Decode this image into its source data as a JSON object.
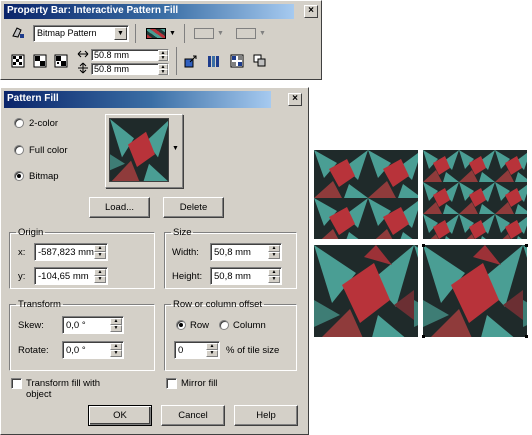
{
  "property_bar": {
    "title": "Property Bar: Interactive Pattern Fill",
    "fill_type": "Bitmap Pattern",
    "width_value": "50.8 mm",
    "height_value": "50.8 mm"
  },
  "dialog": {
    "title": "Pattern Fill",
    "radio_two_color": "2-color",
    "radio_full_color": "Full color",
    "radio_bitmap": "Bitmap",
    "selected_type": "Bitmap",
    "load_label": "Load...",
    "delete_label": "Delete",
    "origin": {
      "legend": "Origin",
      "x_label": "x:",
      "x_value": "-587,823 mm",
      "y_label": "y:",
      "y_value": "-104,65 mm"
    },
    "size": {
      "legend": "Size",
      "width_label": "Width:",
      "width_value": "50,8 mm",
      "height_label": "Height:",
      "height_value": "50,8 mm"
    },
    "transform": {
      "legend": "Transform",
      "skew_label": "Skew:",
      "skew_value": "0,0 °",
      "rotate_label": "Rotate:",
      "rotate_value": "0,0 °"
    },
    "offset": {
      "legend": "Row or column offset",
      "row_label": "Row",
      "column_label": "Column",
      "selected": "Row",
      "amount_value": "0",
      "amount_suffix": "% of tile size"
    },
    "transform_fill_label": "Transform fill with object",
    "mirror_fill_label": "Mirror fill",
    "ok_label": "OK",
    "cancel_label": "Cancel",
    "help_label": "Help"
  },
  "colors": {
    "pattern_red": "#b8333a",
    "pattern_teal": "#4a9e94",
    "pattern_dark": "#1f2a2a",
    "title_start": "#0a246a",
    "title_end": "#a6caf0"
  }
}
